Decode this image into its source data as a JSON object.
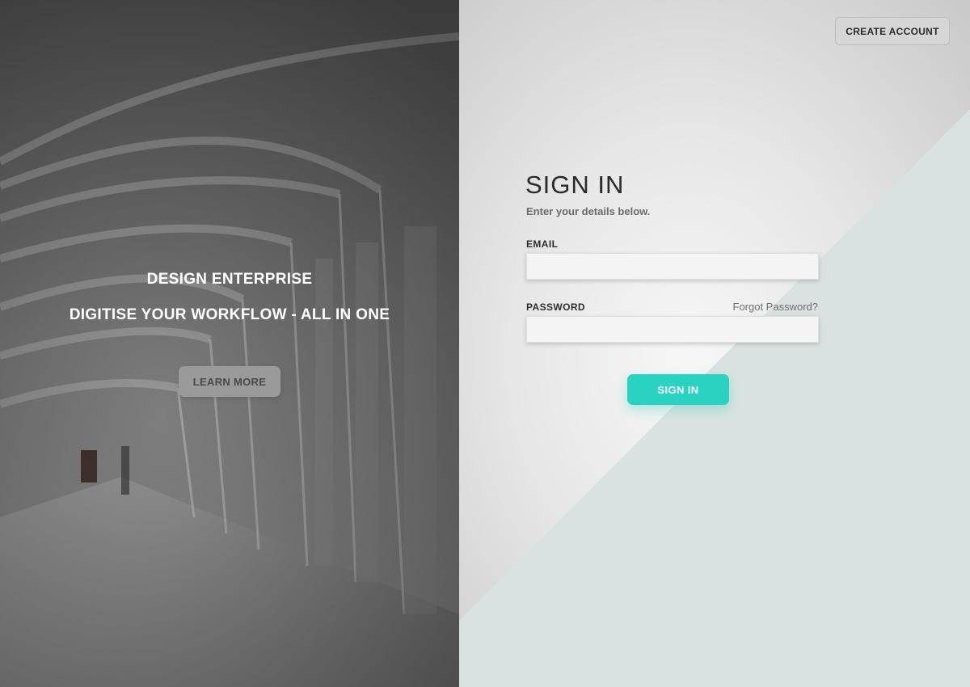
{
  "hero": {
    "title": "DESIGN ENTERPRISE",
    "subtitle": "DIGITISE YOUR WORKFLOW - ALL IN ONE",
    "learn_more_label": "LEARN MORE"
  },
  "header": {
    "create_account_label": "CREATE ACCOUNT"
  },
  "signin": {
    "title": "SIGN IN",
    "subtitle": "Enter your details below.",
    "email_label": "EMAIL",
    "email_value": "",
    "password_label": "PASSWORD",
    "password_value": "",
    "forgot_password_label": "Forgot Password?",
    "submit_label": "SIGN IN"
  },
  "colors": {
    "accent": "#2ad2c1",
    "triangle": "#d9e2e1",
    "hero_overlay": "#6d6d6d"
  }
}
